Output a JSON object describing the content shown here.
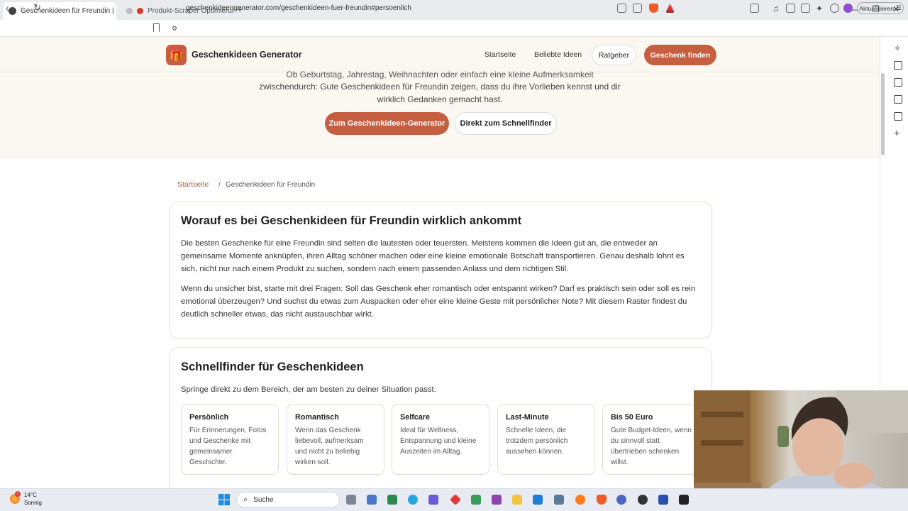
{
  "browser": {
    "tabs": [
      {
        "label": "Geschenkideen für Freundin | pe",
        "favicon_color": "#444444"
      },
      {
        "label": "Produkt-Scraper Optimierung",
        "favicon_color": "#d33b2a"
      }
    ],
    "url": "geschenkideengenerator.com/geschenkideen-fuer-freundin#persoenlich",
    "update_label": "Aktualisieren"
  },
  "site": {
    "brand": "Geschenkideen Generator",
    "nav": [
      "Startseite",
      "Beliebte Ideen",
      "Ratgeber"
    ],
    "cta": "Geschenk finden",
    "accent": "#c65f41"
  },
  "hero": {
    "lines": [
      "Ob Geburtstag, Jahrestag, Weihnachten oder einfach eine kleine Aufmerksamkeit",
      "zwischendurch: Gute Geschenkideen für Freundin zeigen, dass du ihre Vorlieben kennst und dir",
      "wirklich Gedanken gemacht hast."
    ],
    "primary_button": "Zum Geschenkideen-Generator",
    "secondary_button": "Direkt zum Schnellfinder"
  },
  "breadcrumb": {
    "home": "Startseite",
    "separator": "/",
    "current": "Geschenkideen für Freundin"
  },
  "section1": {
    "title": "Worauf es bei Geschenkideen für Freundin wirklich ankommt",
    "p1": "Die besten Geschenke für eine Freundin sind selten die lautesten oder teuersten. Meistens kommen die Ideen gut an, die entweder an gemeinsame Momente anknüpfen, ihren Alltag schöner machen oder eine kleine emotionale Botschaft transportieren. Genau deshalb lohnt es sich, nicht nur nach einem Produkt zu suchen, sondern nach einem passenden Anlass und dem richtigen Stil.",
    "p2": "Wenn du unsicher bist, starte mit drei Fragen: Soll das Geschenk eher romantisch oder entspannt wirken? Darf es praktisch sein oder soll es rein emotional überzeugen? Und suchst du etwas zum Auspacken oder eher eine kleine Geste mit persönlicher Note? Mit diesem Raster findest du deutlich schneller etwas, das nicht austauschbar wirkt."
  },
  "section2": {
    "title": "Schnellfinder für Geschenkideen",
    "intro": "Springe direkt zu dem Bereich, der am besten zu deiner Situation passt.",
    "cards": [
      {
        "title": "Persönlich",
        "desc": "Für Erinnerungen, Fotos und Geschenke mit gemeinsamer Geschichte."
      },
      {
        "title": "Romantisch",
        "desc": "Wenn das Geschenk liebevoll, aufmerksam und nicht zu beliebig wirken soll."
      },
      {
        "title": "Selfcare",
        "desc": "Ideal für Wellness, Entspannung und kleine Auszeiten im Alltag."
      },
      {
        "title": "Last-Minute",
        "desc": "Schnelle Ideen, die trotzdem persönlich aussehen können."
      },
      {
        "title": "Bis 50 Euro",
        "desc": "Gute Budget-Ideen, wenn du sinnvoll statt übertrieben schenken willst."
      }
    ]
  },
  "taskbar": {
    "temperature": "14°C",
    "weather": "Sonnig",
    "weather_badge": "1",
    "search_placeholder": "Suche"
  }
}
